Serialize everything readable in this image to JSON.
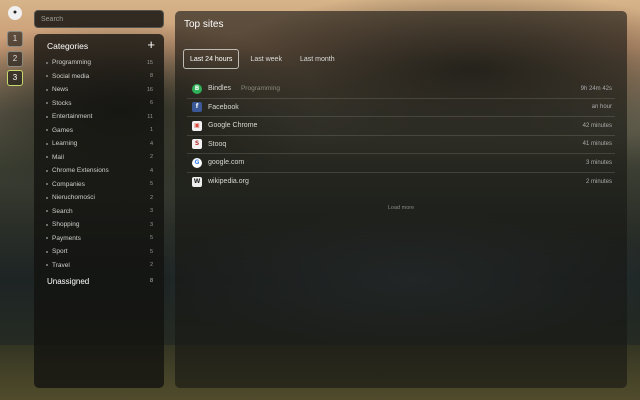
{
  "search": {
    "placeholder": "Search"
  },
  "workspaces": [
    "1",
    "2",
    "3"
  ],
  "categories": {
    "title": "Categories",
    "add_label": "+",
    "items": [
      {
        "label": "Programming",
        "count": "15"
      },
      {
        "label": "Social media",
        "count": "8"
      },
      {
        "label": "News",
        "count": "16"
      },
      {
        "label": "Stocks",
        "count": "6"
      },
      {
        "label": "Entertainment",
        "count": "11"
      },
      {
        "label": "Games",
        "count": "1"
      },
      {
        "label": "Learning",
        "count": "4"
      },
      {
        "label": "Mail",
        "count": "2"
      },
      {
        "label": "Chrome Extensions",
        "count": "4"
      },
      {
        "label": "Companies",
        "count": "5"
      },
      {
        "label": "Nieruchomości",
        "count": "2"
      },
      {
        "label": "Search",
        "count": "3"
      },
      {
        "label": "Shopping",
        "count": "3"
      },
      {
        "label": "Payments",
        "count": "5"
      },
      {
        "label": "Sport",
        "count": "5"
      },
      {
        "label": "Travel",
        "count": "2"
      }
    ],
    "unassigned": {
      "label": "Unassigned",
      "count": "8"
    }
  },
  "top_sites": {
    "title": "Top sites",
    "tabs": [
      {
        "label": "Last 24 hours",
        "active": true
      },
      {
        "label": "Last week",
        "active": false
      },
      {
        "label": "Last month",
        "active": false
      }
    ],
    "rows": [
      {
        "name": "Bindles",
        "tag": "Programming",
        "time": "9h 24m 42s",
        "icon": "bindles-icon",
        "icon_glyph": "B",
        "icon_color": "#2fb15a"
      },
      {
        "name": "Facebook",
        "tag": "",
        "time": "an hour",
        "icon": "facebook-icon",
        "icon_glyph": "f",
        "icon_color": "#3b5998"
      },
      {
        "name": "Google Chrome",
        "tag": "",
        "time": "42 minutes",
        "icon": "chrome-icon",
        "icon_glyph": "▣",
        "icon_color": "#d9463c"
      },
      {
        "name": "Stooq",
        "tag": "",
        "time": "41 minutes",
        "icon": "stooq-icon",
        "icon_glyph": "S",
        "icon_color": "#b03030"
      },
      {
        "name": "google.com",
        "tag": "",
        "time": "3 minutes",
        "icon": "google-icon",
        "icon_glyph": "G",
        "icon_color": "#4285f4"
      },
      {
        "name": "wikipedia.org",
        "tag": "",
        "time": "2 minutes",
        "icon": "wikipedia-icon",
        "icon_glyph": "W",
        "icon_color": "#eeeeee"
      }
    ],
    "load_more": "Load more"
  }
}
